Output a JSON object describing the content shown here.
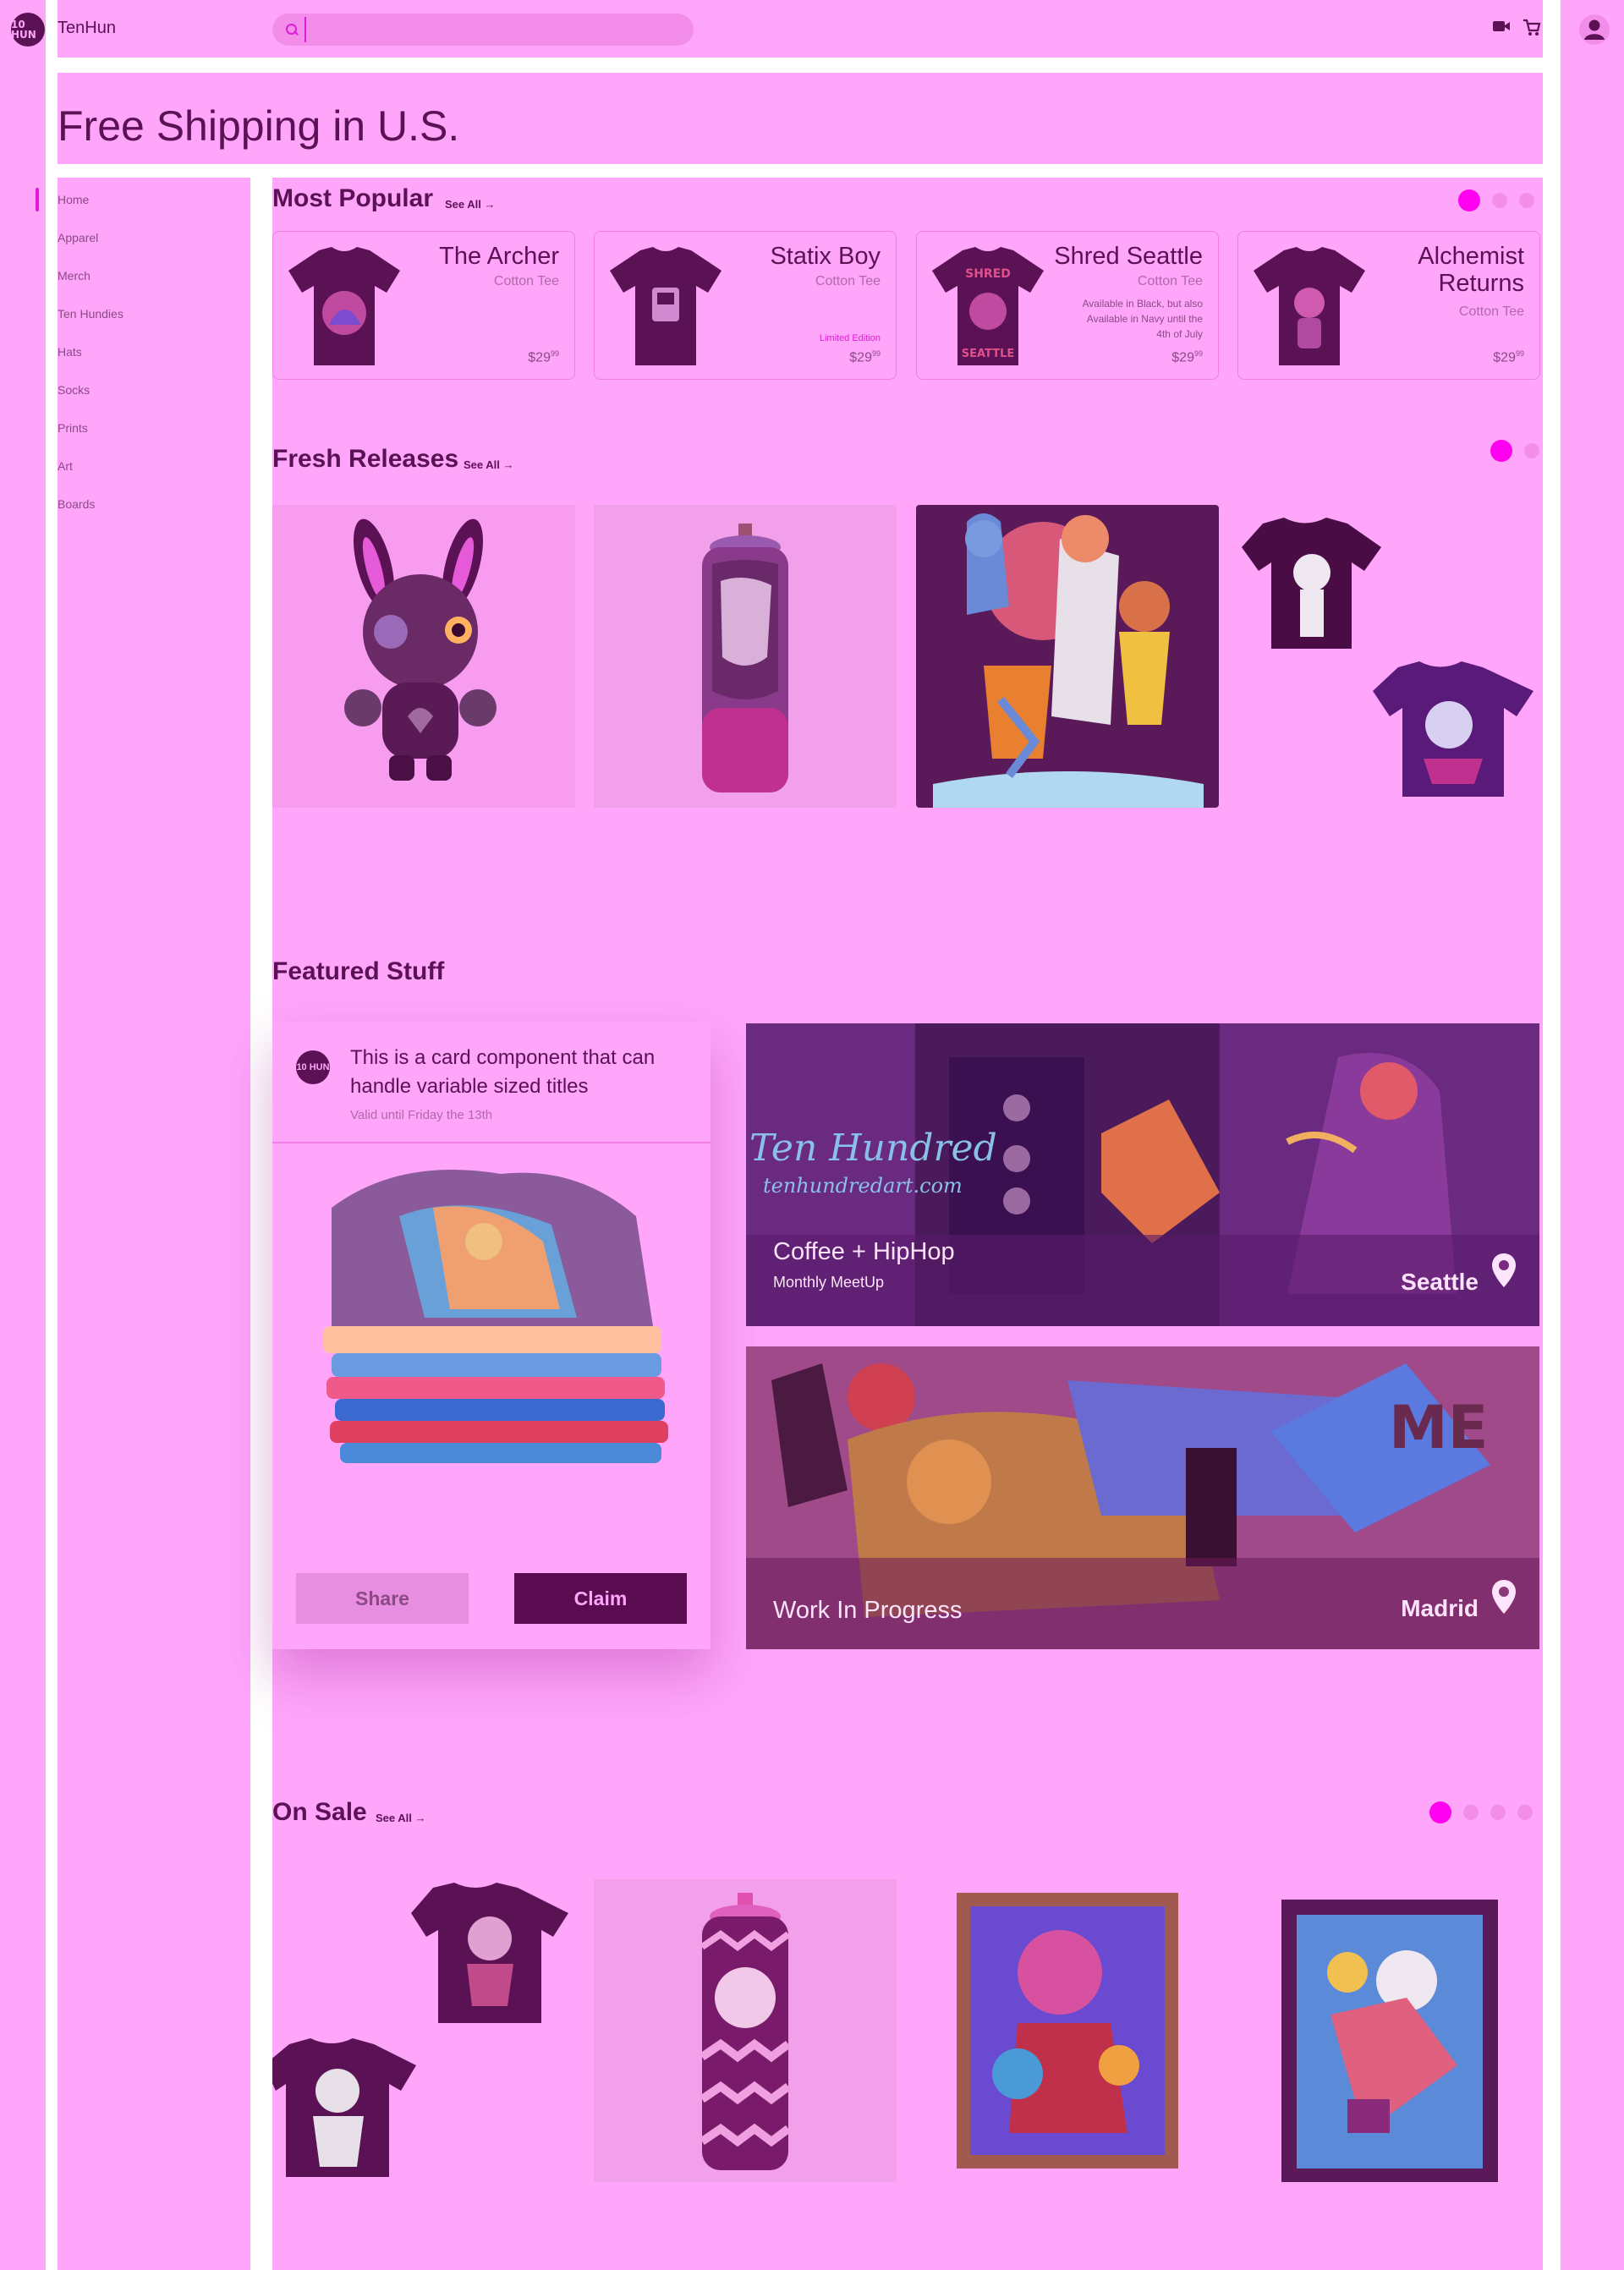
{
  "header": {
    "logo_text": "10 HUN",
    "brand": "TenHun",
    "search_placeholder": ""
  },
  "banner": {
    "title": "Free Shipping in U.S."
  },
  "sidebar": {
    "items": [
      {
        "label": "Home"
      },
      {
        "label": "Apparel"
      },
      {
        "label": "Merch"
      },
      {
        "label": "Ten Hundies"
      },
      {
        "label": "Hats"
      },
      {
        "label": "Socks"
      },
      {
        "label": "Prints"
      },
      {
        "label": "Art"
      },
      {
        "label": "Boards"
      }
    ],
    "active_index": 0
  },
  "most_popular": {
    "title": "Most Popular",
    "see_all": "See All →",
    "carousel_pages": 3,
    "carousel_active": 0,
    "cards": [
      {
        "title": "The Archer",
        "subtitle": "Cotton Tee",
        "note": "",
        "tag": "",
        "price": "$29",
        "price_cents": "99"
      },
      {
        "title": "Statix Boy",
        "subtitle": "Cotton Tee",
        "note": "",
        "tag": "Limited Edition",
        "price": "$29",
        "price_cents": "99"
      },
      {
        "title": "Shred Seattle",
        "subtitle": "Cotton Tee",
        "note": "Available in Black, but also Available in Navy until the 4th of July",
        "tag": "",
        "price": "$29",
        "price_cents": "99"
      },
      {
        "title": "Alchemist Returns",
        "subtitle": "Cotton Tee",
        "note": "",
        "tag": "",
        "price": "$29",
        "price_cents": "99"
      }
    ]
  },
  "fresh_releases": {
    "title": "Fresh Releases",
    "see_all": "See All →",
    "carousel_pages": 2,
    "carousel_active": 0,
    "tiles": [
      "vinyl-bunny-figure",
      "painted-spray-can",
      "cartoon-art-print",
      "black-tee",
      "purple-tee"
    ]
  },
  "featured": {
    "title": "Featured Stuff",
    "card": {
      "avatar_text": "10 HUN",
      "title": "This is a card component that can handle variable sized titles",
      "subtitle": "Valid until Friday the 13th",
      "share_label": "Share",
      "claim_label": "Claim"
    },
    "events": [
      {
        "title": "Coffee + HipHop",
        "subtitle": "Monthly MeetUp",
        "location": "Seattle",
        "wall_text": "Ten Hundred",
        "wall_url": "tenhundredart.com"
      },
      {
        "title": "Work In Progress",
        "subtitle": "",
        "location": "Madrid",
        "wall_text": "",
        "wall_url": ""
      }
    ]
  },
  "on_sale": {
    "title": "On Sale",
    "see_all": "See All →",
    "carousel_pages": 4,
    "carousel_active": 0,
    "tiles": [
      "tee-pair",
      "chevron-spray-can",
      "framed-print-1",
      "framed-print-2"
    ]
  },
  "colors": {
    "background": "#ffa6fb",
    "text_dark": "#5a1255",
    "accent": "#ff00f0",
    "claim_button": "#5a0c50"
  }
}
